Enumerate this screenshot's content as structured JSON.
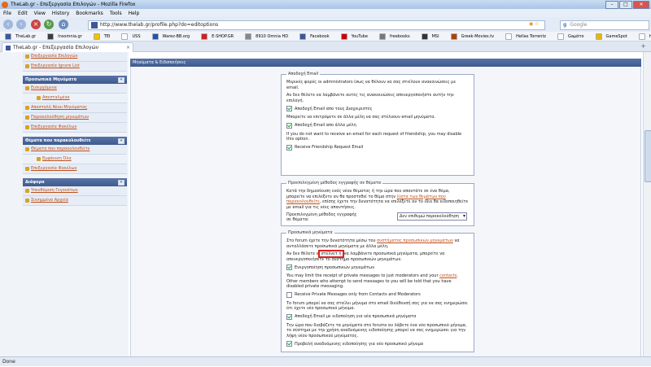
{
  "window": {
    "title": "TheLab.gr - Επεξεργασία Επιλογών - Mozilla Firefox",
    "min": "–",
    "max": "□",
    "close": "✕"
  },
  "menu": [
    "File",
    "Edit",
    "View",
    "History",
    "Bookmarks",
    "Tools",
    "Help"
  ],
  "nav": {
    "url": "http://www.thelab.gr/profile.php?do=editoptions",
    "search_placeholder": "Google",
    "search_engine_glyph": "g"
  },
  "bookmarks": [
    {
      "label": "TheLab.gr",
      "color": "#3b5998"
    },
    {
      "label": "Insomnia.gr",
      "color": "#3b3b3b"
    },
    {
      "label": "TEI",
      "color": "#f2c200"
    },
    {
      "label": "USS",
      "color": "#ffffff"
    },
    {
      "label": "Warez-BB.org",
      "color": "#2255aa"
    },
    {
      "label": "E-SHOP.GR",
      "color": "#cc2222"
    },
    {
      "label": "8910 Omnia HD",
      "color": "#888888"
    },
    {
      "label": "Facebook",
      "color": "#3b5998"
    },
    {
      "label": "YouTube",
      "color": "#cc0000"
    },
    {
      "label": "freebooks",
      "color": "#777777"
    },
    {
      "label": "MSI",
      "color": "#333333"
    },
    {
      "label": "Greek-Movies.tv",
      "color": "#aa4400"
    },
    {
      "label": "Hellas Torrentz",
      "color": "#ffffff"
    },
    {
      "label": "Gaμάτο",
      "color": "#ffffff"
    },
    {
      "label": "GameSpot",
      "color": "#e6b800"
    },
    {
      "label": "HX Releases",
      "color": "#ffffff"
    }
  ],
  "tab": {
    "label": "TheLab.gr - Επεξεργασία Επιλογών",
    "close": "×",
    "new": "+"
  },
  "sidebar": {
    "top_items": [
      "Επεξεργασία Επιλογών",
      "Επεξεργασία Ignore List"
    ],
    "sections": [
      {
        "title": "Προσωπικά Μηνύματα",
        "toggle": "«",
        "items": [
          {
            "label": "Εισερχόμενα",
            "sub": false
          },
          {
            "label": "Απεσταλμένα",
            "sub": true
          },
          {
            "label": "Αποστολή Νέου Μηνύματος",
            "sub": false
          },
          {
            "label": "Παρακολούθηση μηνυμάτων",
            "sub": false
          },
          {
            "label": "Επεξεργασία Φακέλων",
            "sub": false
          }
        ]
      },
      {
        "title": "Θέματα που παρακολουθείτε",
        "toggle": "«",
        "items": [
          {
            "label": "Θέματα που παρακολουθείτε",
            "sub": false
          },
          {
            "label": "Εμφάνιση Όλα",
            "sub": true
          },
          {
            "label": "Επεξεργασία Φακέλων",
            "sub": false
          }
        ]
      },
      {
        "title": "Διάφορα",
        "toggle": "«",
        "items": [
          {
            "label": "Υπενθύμιση Γεγονότων",
            "sub": false
          },
          {
            "label": "Συνημμένα Αρχεία",
            "sub": false
          }
        ]
      }
    ]
  },
  "main": {
    "header": "Μηνύματα & Ειδοποιήσεις",
    "fs1": {
      "legend": "Αποδοχή Email",
      "p1": "Μερικές φορές οι administrators ίσως να θέλουν να σας στείλουν ανακοινώσεις με email.",
      "p2": "Αν δεν θέλετε να λαμβάνετε αυτές τις ανακοινώσεις απενεργοποιήστε αυτήν την επιλογή.",
      "cb1": "Αποδοχή Email απο τους Διαχειριστές",
      "p3": "Μπορείτε να επιτρέψετε σε άλλα μέλη να σας στέλνουν email μηνύματα.",
      "cb2": "Αποδοχή Email απο άλλα μέλη",
      "p4": "If you do not want to receive an email for each request of friendship, you may disable this option.",
      "cb3": "Receive Friendship Request Email"
    },
    "fs2": {
      "legend": "Προεπιλεγμένη μέθοδος εγγραφής σε θέματα",
      "p1a": "Κατά την δημοσίευση ενός νέου θέματος ή την ώρα που απαντάτε σε ένα θέμα, μπορείτε να επιλέξετε αν θα προστεθεί το θέμα στην ",
      "p1link": "λίστα των θεμάτων που παρακολουθείτε",
      "p1b": ", επίσης έχετε την δυνατότητα να επιλέξετε αν το ίδιο θα ειδοποιηθείτε με email για τις νέες απαντήσεις.",
      "label": "Προεπιλεγμένη μέθοδος εγγραφής σε θέματα:",
      "select": "Δεν επιθυμώ παρακολούθηση"
    },
    "fs3": {
      "legend": "Προσωπικά μηνύματα",
      "p1a": "Στο forum έχετε την δυνατότητα μέσω του ",
      "p1link": "συστήματος προσωπικών μηνυμάτων",
      "p1b": " να ανταλλάσετε προσωπικά μηνύματα με άλλα μέλη.",
      "p2a": "Αν δεν θέλετε ν",
      "p2hl": "στέλνετ ή",
      "p2b": "να λαμβάνετε προσωπικά μηνύματα, μπορείτε να απενεργοποιήσετε το σύστημα προσωπικών μηνυμάτων.",
      "cb1": "Ενεργοποίηση προσωπικών μηνυμάτων",
      "p3a": "You may limit the receipt of private messages to just moderators and your ",
      "p3link": "contacts",
      "p3b": ". Other members who attempt to send messages to you will be told that you have disabled private messaging.",
      "cb2": "Receive Private Messages only from Contacts and Moderators",
      "p4": "Το forum μπορεί να σας στείλει μήνυμα στο email διεύθυνσή σας για να σας ενημερώσει ότι έχετε νέο προσωπικό μήνυμα.",
      "cb3": "Αποδοχή Email με ειδοποίηση για νέα προσωπικά μηνύματα",
      "p5": "Την ώρα που διαβάζετε τα μηνύματα στο forums αν λάβετε ένα νέο προσωπικό μήνυμα, το σύστημα με την χρήση αναδυόμενης ειδοποίησης μπορεί να σας ενημερώσει για την λήψη νέου προσωπικού μηνύματος.",
      "cb4": "Προβολή αναδυόμενης ειδοποίησης για νέο προσωπικό μήνυμα"
    }
  },
  "status": "Done"
}
